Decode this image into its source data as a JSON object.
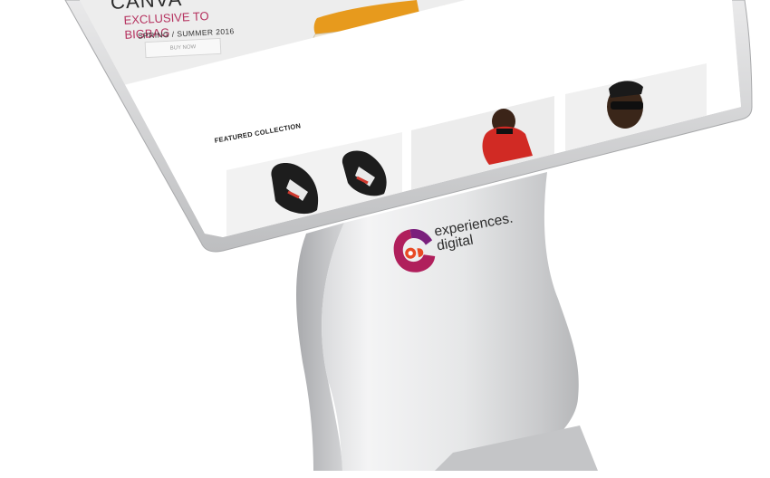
{
  "screen": {
    "hero": {
      "title": "CANVA",
      "exclusive": "EXCLUSIVE TO BIGBAG",
      "season": "SPRING / SUMMER 2016",
      "button": "BUY NOW"
    },
    "carousel": {
      "active_index": 1,
      "count": 3,
      "accent_color": "#2ab0b8"
    },
    "featured": {
      "title": "FEATURED COLLECTION"
    }
  },
  "stand": {
    "brand_line1": "experiences.",
    "brand_line2": "digital",
    "logo_colors": [
      "#b01f5c",
      "#e84a24",
      "#7a1f7c"
    ]
  }
}
